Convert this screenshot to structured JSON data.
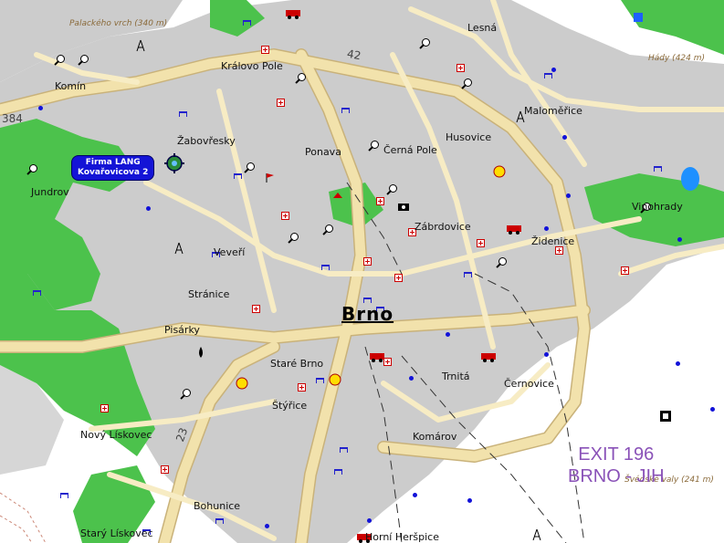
{
  "map": {
    "place_labels": [
      {
        "id": "palackeho-vrch",
        "text": "Palackého vrch (340 m)",
        "style": "small"
      },
      {
        "id": "lesna",
        "text": "Lesná",
        "style": "normal"
      },
      {
        "id": "hady",
        "text": "Hády (424 m)",
        "style": "small"
      },
      {
        "id": "kralovo-pole",
        "text": "Královo Pole",
        "style": "normal"
      },
      {
        "id": "komin",
        "text": "Komín",
        "style": "normal"
      },
      {
        "id": "malomerice",
        "text": "Maloměřice",
        "style": "normal"
      },
      {
        "id": "zabovresky",
        "text": "Žabovřesky",
        "style": "normal"
      },
      {
        "id": "ponava",
        "text": "Ponava",
        "style": "normal"
      },
      {
        "id": "cerna-pole",
        "text": "Černá Pole",
        "style": "normal"
      },
      {
        "id": "husovice",
        "text": "Husovice",
        "style": "normal"
      },
      {
        "id": "jundrov",
        "text": "Jundrov",
        "style": "normal"
      },
      {
        "id": "vinohrady",
        "text": "Vinohrady",
        "style": "normal"
      },
      {
        "id": "zabrdovice",
        "text": "Zábrdovice",
        "style": "normal"
      },
      {
        "id": "zidenice",
        "text": "Židenice",
        "style": "normal"
      },
      {
        "id": "veveri",
        "text": "Veveří",
        "style": "normal"
      },
      {
        "id": "stranice",
        "text": "Stránice",
        "style": "normal"
      },
      {
        "id": "pisarky",
        "text": "Pisárky",
        "style": "normal"
      },
      {
        "id": "stare-brno",
        "text": "Staré Brno",
        "style": "normal"
      },
      {
        "id": "trnita",
        "text": "Trnitá",
        "style": "normal"
      },
      {
        "id": "cernovice",
        "text": "Černovice",
        "style": "normal"
      },
      {
        "id": "styrice",
        "text": "Štýřice",
        "style": "normal"
      },
      {
        "id": "novy-liskovec",
        "text": "Nový Lískovec",
        "style": "normal"
      },
      {
        "id": "komarov",
        "text": "Komárov",
        "style": "normal"
      },
      {
        "id": "svedske-valy",
        "text": "Švédské valy (241 m)",
        "style": "small"
      },
      {
        "id": "bohunice",
        "text": "Bohunice",
        "style": "normal"
      },
      {
        "id": "stary-liskovec",
        "text": "Starý Lískovec",
        "style": "normal"
      },
      {
        "id": "horni-herspice",
        "text": "Horní Heršpice",
        "style": "normal"
      }
    ],
    "road_numbers": [
      {
        "id": "road-384",
        "text": "384"
      },
      {
        "id": "road-42",
        "text": "42"
      },
      {
        "id": "road-23",
        "text": "23"
      }
    ],
    "city_label": "Brno",
    "callout": {
      "line1": "Firma LANG",
      "line2": "Kovařovicova 2"
    },
    "exit_label": {
      "line1": "EXIT 196",
      "line2": "BRNO - JIH"
    },
    "colors": {
      "forest": "#4cc24c",
      "urban": "#cccccc",
      "road": "#f2e2ac",
      "road_edge": "#c9b27a",
      "water": "#1e90ff",
      "callout_bg": "#1414d6",
      "exit_text": "#8a52b8",
      "hospital": "#cc0000",
      "poi_blue": "#1212d8"
    },
    "icons": [
      "hospital-icon",
      "bench-icon",
      "magnifier-pin-icon",
      "bus-stop-dot-icon",
      "globe-waypoint-icon",
      "train-icon",
      "atm-icon",
      "camera-icon",
      "tower-icon"
    ]
  }
}
